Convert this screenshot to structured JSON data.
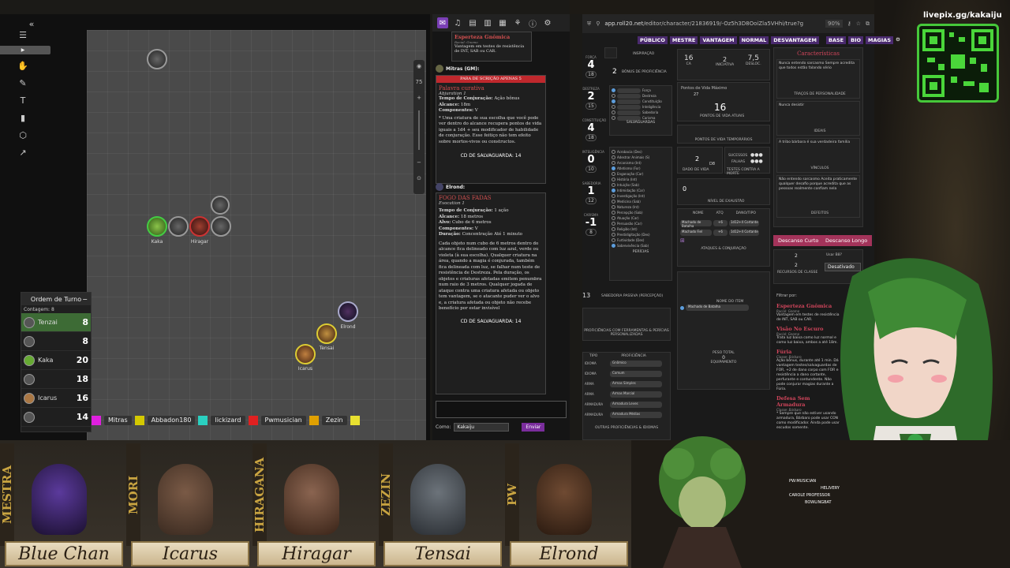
{
  "vtt": {
    "tokens": [
      {
        "label": "Kaka"
      },
      {
        "label": "Hiragar"
      },
      {
        "label": "Elrond"
      },
      {
        "label": "Tensai"
      },
      {
        "label": "Icarus"
      }
    ],
    "zoom_value": "75",
    "turn_order": {
      "title": "Ordem de Turno",
      "count": "Contagem: 8",
      "rows": [
        {
          "name": "Tenzai",
          "value": "8"
        },
        {
          "name": "",
          "value": "8"
        },
        {
          "name": "Kaka",
          "value": "20"
        },
        {
          "name": "",
          "value": "18"
        },
        {
          "name": "Icarus",
          "value": "16"
        },
        {
          "name": "",
          "value": "14"
        }
      ]
    },
    "players": [
      {
        "name": "Mitras",
        "color": "#e020e0"
      },
      {
        "name": "Abbadon180",
        "color": "#d4c900"
      },
      {
        "name": "lickizard",
        "color": "#2ad0c0"
      },
      {
        "name": "Pwmusician",
        "color": "#e02020"
      },
      {
        "name": "Zezin",
        "color": "#e0a000"
      }
    ],
    "last_swatch": "#e8e030"
  },
  "chat": {
    "card0": {
      "title": "Esperteza Gnômica",
      "sub": "Racial: Gnomo",
      "desc": "Vantagem em testes de resistência de INT, SAB ou CAR."
    },
    "msg1": {
      "author": "Mitras (GM):",
      "banner": "PARA DE SCRIÇÃO APENAS 5",
      "spell": "Palavra curativa",
      "school": "Abjuration 1",
      "time_label": "Tempo de Conjuração:",
      "time": "Ação bônus",
      "range_label": "Alcance:",
      "range": "18m",
      "comp_label": "Componentes:",
      "comp": "V",
      "desc": "* Uma criatura de sua escolha que você pode ver dentro do alcance recupera pontos de vida iguais a 1d4 + seu modificador de habilidade de conjuração. Esse feitiço não tem efeito sobre mortos-vivos ou constructos.",
      "save": "CD DE SALVAGUARDA: 14"
    },
    "msg2": {
      "author": "Elrond:",
      "spell": "FOGO DAS FADAS",
      "school": "Evocation 1",
      "time_label": "Tempo de Conjuração:",
      "time": "1 ação",
      "range_label": "Alcance:",
      "range": "18 metros",
      "target_label": "Alvo:",
      "target": "Cubo de 6 metros",
      "comp_label": "Componentes:",
      "comp": "V",
      "dur_label": "Duração:",
      "dur": "Concentração Até 1 minuto",
      "desc": "Cada objeto num cubo de 6 metros dentro do alcance fica delineado com luz azul, verde ou violeta (à sua escolha). Qualquer criatura na área, quando a magia é conjurada, também fica delineada com luz, se falhar num teste de resistência de Destreza. Pela duração, os objetos e criaturas afetadas emitem penumbra num raio de 3 metros. Qualquer jogada de ataque contra uma criatura afetada ou objeto tem vantagem, se o atacante puder ver o alvo e, a criatura afetada ou objeto não recebe benefício por estar invisível",
      "save": "CD DE SALVAGUARDA: 14"
    },
    "as_label": "Como:",
    "as_value": "Kakaiju",
    "send": "Enviar"
  },
  "sheet": {
    "url_host": "app.roll20.net",
    "url_path": "/editor/character/21836919/-Oz5h3D8OoiZla5VHhi/true?g",
    "zoom": "90%",
    "nav": [
      "PÚBLICO",
      "MESTRE",
      "VANTAGEM",
      "NORMAL",
      "DESVANTAGEM",
      "BASE",
      "BIO",
      "MAGIAS"
    ],
    "inspiration": "INSPIRAÇÃO",
    "prof_bonus": "2",
    "prof_label": "BÔNUS DE PROFICIÊNCIA",
    "abilities": [
      {
        "lab": "FORÇA",
        "num": "4",
        "mod": "18"
      },
      {
        "lab": "DESTREZA",
        "num": "2",
        "mod": "15"
      },
      {
        "lab": "CONSTITUIÇÃO",
        "num": "4",
        "mod": "18"
      },
      {
        "lab": "INTELIGÊNCIA",
        "num": "0",
        "mod": "10"
      },
      {
        "lab": "SABEDORIA",
        "num": "1",
        "mod": "12"
      },
      {
        "lab": "CARISMA",
        "num": "-1",
        "mod": "8"
      }
    ],
    "saves_title": "SALVAGUARDAS",
    "saves": [
      "Força",
      "Destreza",
      "Constituição",
      "Inteligência",
      "Sabedoria",
      "Carisma"
    ],
    "skills_title": "PERÍCIAS",
    "skills": [
      "Acrobacia (Des)",
      "Adestrar Animais (S)",
      "Arcanismo (Int)",
      "Atletismo (For)",
      "Enganação (Car)",
      "História (Int)",
      "Intuição (Sab)",
      "Intimidação (Car)",
      "Investigação (Int)",
      "Medicina (Sab)",
      "Natureza (Int)",
      "Percepção (Sab)",
      "Atuação (Car)",
      "Persuasão (Car)",
      "Religião (Int)",
      "Prestidigitação (Des)",
      "Furtividade (Des)",
      "Sobrevivência (Sab)"
    ],
    "passive": "13",
    "passive_label": "SABEDORIA PASSIVA (PERCEPÇÃO)",
    "ca": "16",
    "ca_label": "CA",
    "init": "2",
    "init_label": "INICIATIVA",
    "speed": "7,5",
    "speed_label": "DESLOC.",
    "hp_max_label": "Pontos de Vida Máximo",
    "hp_max": "27",
    "hp_cur": "16",
    "hp_cur_label": "PONTOS DE VIDA ATUAIS",
    "hp_temp_label": "PONTOS DE VIDA TEMPORÁRIOS",
    "hit_dice": "2",
    "hit_dice_label": "DADO DE VIDA",
    "hit_die": "D8",
    "death_label": "TESTES CONTRA A MORTE",
    "success": "SUCESSOS",
    "fail": "FALHAS",
    "exhaust": "0",
    "exhaust_label": "NÍVEL DE EXAUSTÃO",
    "attacks_cols": [
      "NOME",
      "ATQ",
      "DANO/TIPO"
    ],
    "attacks": [
      {
        "name": "Machado de Batalha",
        "atq": "+6",
        "dmg": "1d12+4 Cortante"
      },
      {
        "name": "Machado Fiel",
        "atq": "+6",
        "dmg": "1d12+4 Cortante"
      }
    ],
    "attacks_title": "ATAQUES & CONJURAÇÃO",
    "item_col": "NOME DO ITEM",
    "item": "Machado de Batalha",
    "weight_label": "PESO TOTAL",
    "weight": "0",
    "equip_label": "EQUIPAMENTO",
    "tools_title": "PROFICIÊNCIAS COM FERRAMENTAS & PERÍCIAS PERSONALIZADAS",
    "prof_cols": [
      "TIPO",
      "PROFICIÊNCIA"
    ],
    "profs": [
      {
        "tipo": "IDIOMA",
        "prof": "Gnômico"
      },
      {
        "tipo": "IDIOMA",
        "prof": "Comum"
      },
      {
        "tipo": "ARMA",
        "prof": "Armas Simples"
      },
      {
        "tipo": "ARMA",
        "prof": "Armas Marcial"
      },
      {
        "tipo": "ARMADURA",
        "prof": "Armadura Leves"
      },
      {
        "tipo": "ARMADURA",
        "prof": "Armadura Médias"
      }
    ],
    "other_title": "OUTRAS PROFICIÊNCIAS & IDIOMAS",
    "traits_title": "Características",
    "traits": [
      {
        "text": "Nunca entendo sarcasmo Sempre acredita que todos estão falando sério",
        "label": "TRAÇOS DE PERSONALIDADE"
      },
      {
        "text": "Nunca desistir",
        "label": "IDEAIS"
      },
      {
        "text": "A tribo bárbara é sua verdadeira família",
        "label": "VÍNCULOS"
      },
      {
        "text": "Não entendo sarcasmo Aceita praticamente qualquer desafio porque acredita que as pessoas realmente confiam nela",
        "label": "DEFEITOS"
      }
    ],
    "short_rest": "Descanso Curto",
    "long_rest": "Descanso Longo",
    "filter": "Filtrar por:",
    "features": [
      {
        "t": "Esperteza Gnômica",
        "s": "Racial: Gnomo",
        "d": "Vantagem em testes de resistência de INT, SAB ou CAR."
      },
      {
        "t": "Visão No Escuro",
        "s": "Racial: Gnomo",
        "d": "Trata luz baixa como luz normal e como luz baixa, ambos a até 18m."
      },
      {
        "t": "Fúria",
        "s": "Classe: Bárbaro",
        "d": "Ação bônus, durante até 1 min. Dá vantagem testes/salvaguardas de FOR, +2 de dano corpo com FOR e resistência a dano cortante, perfurante e contundente. Não pode conjurar magias durante a Fúria."
      },
      {
        "t": "Defesa Sem Armadura",
        "s": "Classe: Bárbaro",
        "d": "* Sempre que não estiver usando armadura, Bárbaro pode usar CON como modificador. Ainda pode usar escudos somente."
      }
    ],
    "class_res_label": "RECURSOS DE CLASSE",
    "res_total": "2",
    "res_used": "2",
    "use_label": "Usar B8?",
    "res_state": "Desativado"
  },
  "overlay": {
    "qr_label": "livepix.gg/kakaiju",
    "viewers": [
      "PW:MUSICIAN",
      "HELIVERY",
      "CAROLE PROFESSOR",
      "BOWLINGBAT"
    ]
  },
  "banner": [
    {
      "tag": "MESTRA",
      "name": "Blue Chan"
    },
    {
      "tag": "MORI",
      "name": "Icarus"
    },
    {
      "tag": "HIRAGANA",
      "name": "Hiragar"
    },
    {
      "tag": "ZEZIN",
      "name": "Tensai"
    },
    {
      "tag": "PW",
      "name": "Elrond"
    }
  ]
}
